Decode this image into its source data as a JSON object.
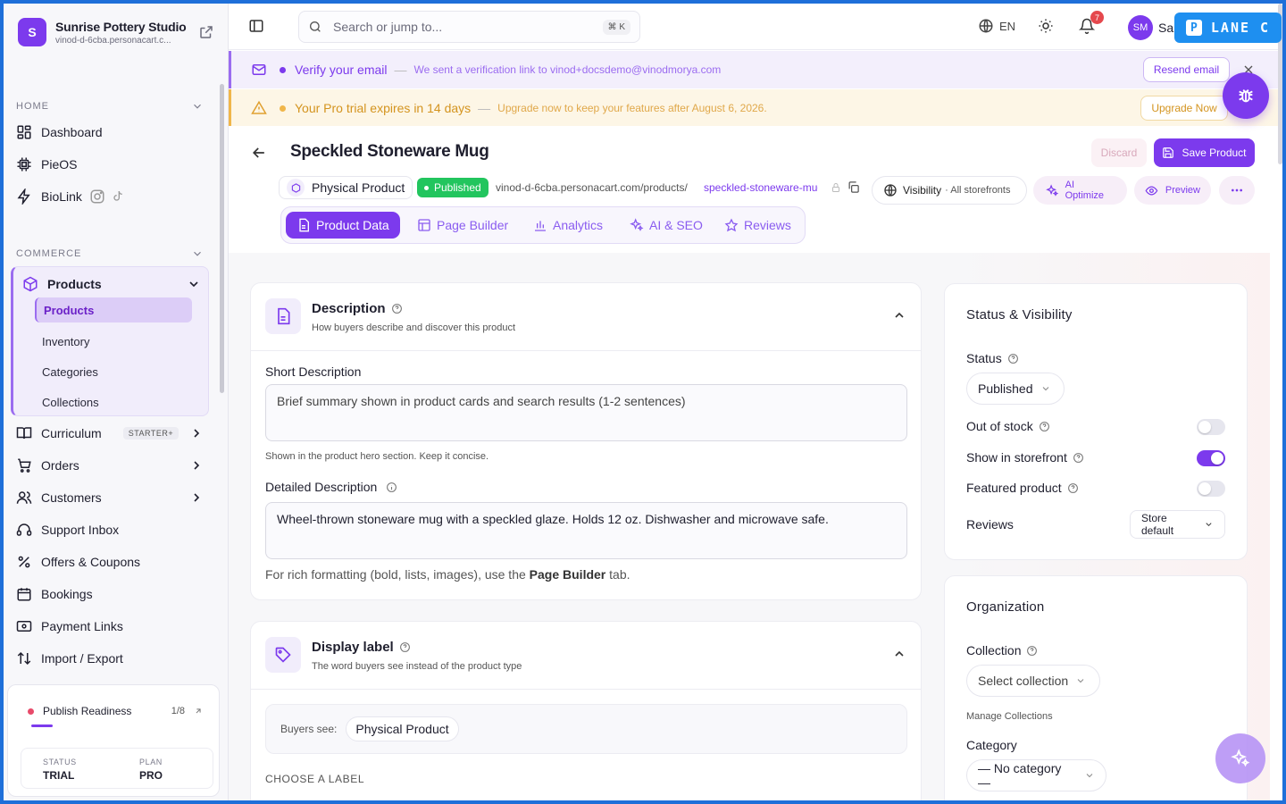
{
  "brand": {
    "initial": "S",
    "name": "Sunrise Pottery Studio",
    "url": "vinod-d-6cba.personacart.c..."
  },
  "sidebar": {
    "home_header": "HOME",
    "home_items": [
      {
        "label": "Dashboard",
        "icon": "dashboard-icon"
      },
      {
        "label": "PieOS",
        "icon": "chip-icon"
      },
      {
        "label": "BioLink",
        "icon": "bolt-icon"
      }
    ],
    "commerce_header": "COMMERCE",
    "products": {
      "label": "Products",
      "sub_items": [
        {
          "label": "Products",
          "active": true
        },
        {
          "label": "Inventory"
        },
        {
          "label": "Categories"
        },
        {
          "label": "Collections"
        }
      ]
    },
    "curriculum": {
      "label": "Curriculum",
      "badge": "STARTER+"
    },
    "items": [
      {
        "label": "Orders",
        "icon": "cart-icon"
      },
      {
        "label": "Customers",
        "icon": "users-icon"
      },
      {
        "label": "Support Inbox",
        "icon": "headset-icon"
      },
      {
        "label": "Offers & Coupons",
        "icon": "percent-icon"
      },
      {
        "label": "Bookings",
        "icon": "calendar-icon"
      },
      {
        "label": "Payment Links",
        "icon": "payment-icon"
      },
      {
        "label": "Import / Export",
        "icon": "import-export-icon"
      }
    ],
    "readiness": {
      "label": "Publish Readiness",
      "count": "1/8",
      "progress": 0.125
    },
    "status_label": "STATUS",
    "status_value": "TRIAL",
    "plan_label": "PLAN",
    "plan_value": "PRO"
  },
  "topbar": {
    "search_placeholder": "Search or jump to...",
    "search_shortcut": "⌘ K",
    "language": "EN",
    "notifications_count": "7",
    "avatar_initials": "SM",
    "user_name_partial": "Sa",
    "lane_label": "LANE C",
    "lane_logo": "P"
  },
  "banners": {
    "email": {
      "title": "Verify your email",
      "message": "We sent a verification link to vinod+docsdemo@vinodmorya.com",
      "button": "Resend email"
    },
    "trial": {
      "title": "Your Pro trial expires in 14 days",
      "message": "Upgrade now to keep your features after August 6, 2026.",
      "button": "Upgrade Now"
    }
  },
  "product": {
    "title": "Speckled Stoneware Mug",
    "discard_label": "Discard",
    "save_label": "Save Product",
    "type": "Physical Product",
    "status_badge": "Published",
    "url_base": "vinod-d-6cba.personacart.com/products/",
    "url_slug": "speckled-stoneware-mug",
    "visibility_label": "Visibility",
    "visibility_value": "· All storefronts",
    "ai_optimize": "AI Optimize",
    "preview": "Preview"
  },
  "tabs": [
    {
      "label": "Product Data",
      "active": true
    },
    {
      "label": "Page Builder"
    },
    {
      "label": "Analytics"
    },
    {
      "label": "AI & SEO"
    },
    {
      "label": "Reviews"
    }
  ],
  "description_card": {
    "title": "Description",
    "subtitle": "How buyers describe and discover this product",
    "short_label": "Short Description",
    "short_placeholder": "Brief summary shown in product cards and search results (1-2 sentences)",
    "short_hint": "Shown in the product hero section. Keep it concise.",
    "detailed_label": "Detailed Description",
    "detailed_value": "Wheel-thrown stoneware mug with a speckled glaze. Holds 12 oz. Dishwasher and microwave safe.",
    "rich_hint_prefix": "For rich formatting (bold, lists, images), use the",
    "rich_hint_link": "Page Builder",
    "rich_hint_suffix": "tab."
  },
  "display_label_card": {
    "title": "Display label",
    "subtitle": "The word buyers see instead of the product type",
    "buyers_see": "Buyers see:",
    "buyers_value": "Physical Product",
    "choose_label": "CHOOSE A LABEL"
  },
  "status_card": {
    "title": "Status & Visibility",
    "status_label": "Status",
    "status_value": "Published",
    "out_of_stock": "Out of stock",
    "out_of_stock_on": false,
    "show_storefront": "Show in storefront",
    "show_storefront_on": true,
    "featured": "Featured product",
    "featured_on": false,
    "reviews_label": "Reviews",
    "reviews_value": "Store default"
  },
  "organization_card": {
    "title": "Organization",
    "collection_label": "Collection",
    "collection_value": "Select collection",
    "manage_collections": "Manage Collections",
    "category_label": "Category",
    "category_value": "— No category —"
  },
  "colors": {
    "accent": "#7c3aed",
    "success": "#22c55e",
    "warning": "#f0b64a",
    "frame": "#1e6fd9"
  }
}
